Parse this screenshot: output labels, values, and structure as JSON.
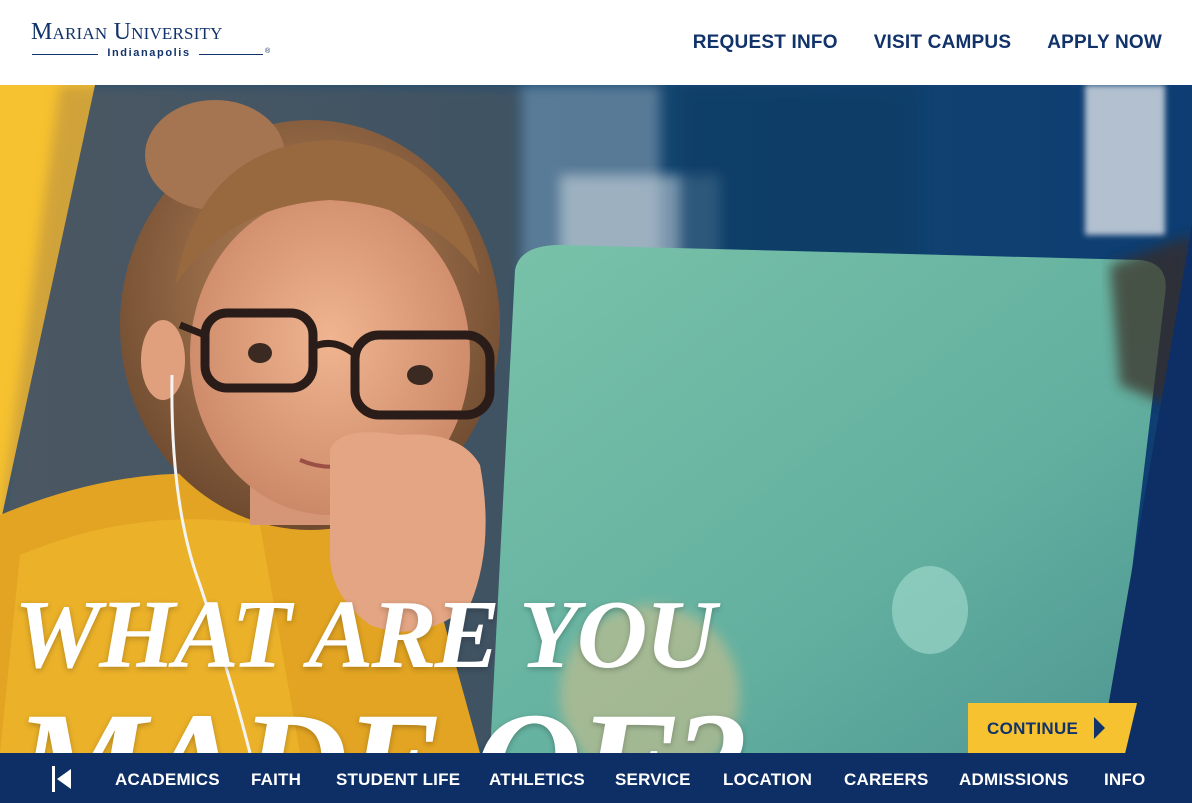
{
  "logo": {
    "name_line1": "Marian University",
    "name_line2": "Indianapolis",
    "registered_mark": "®"
  },
  "top_nav": {
    "items": [
      "REQUEST INFO",
      "VISIT CAMPUS",
      "APPLY NOW"
    ]
  },
  "hero": {
    "headline_line1": "WHAT ARE YOU",
    "headline_line2": "MADE OF?",
    "image_description_icon": "student-with-laptop-photo"
  },
  "continue_button": {
    "label": "CONTINUE",
    "icon": "triangle-right-icon"
  },
  "bottom_nav": {
    "first_icon": "skip-to-start-icon",
    "items": [
      "ACADEMICS",
      "FAITH",
      "STUDENT LIFE",
      "ATHLETICS",
      "SERVICE",
      "LOCATION",
      "CAREERS",
      "ADMISSIONS",
      "INFO"
    ]
  },
  "colors": {
    "brand_navy": "#0e2f66",
    "brand_gold": "#f7c22f",
    "text_navy": "#12336a"
  }
}
